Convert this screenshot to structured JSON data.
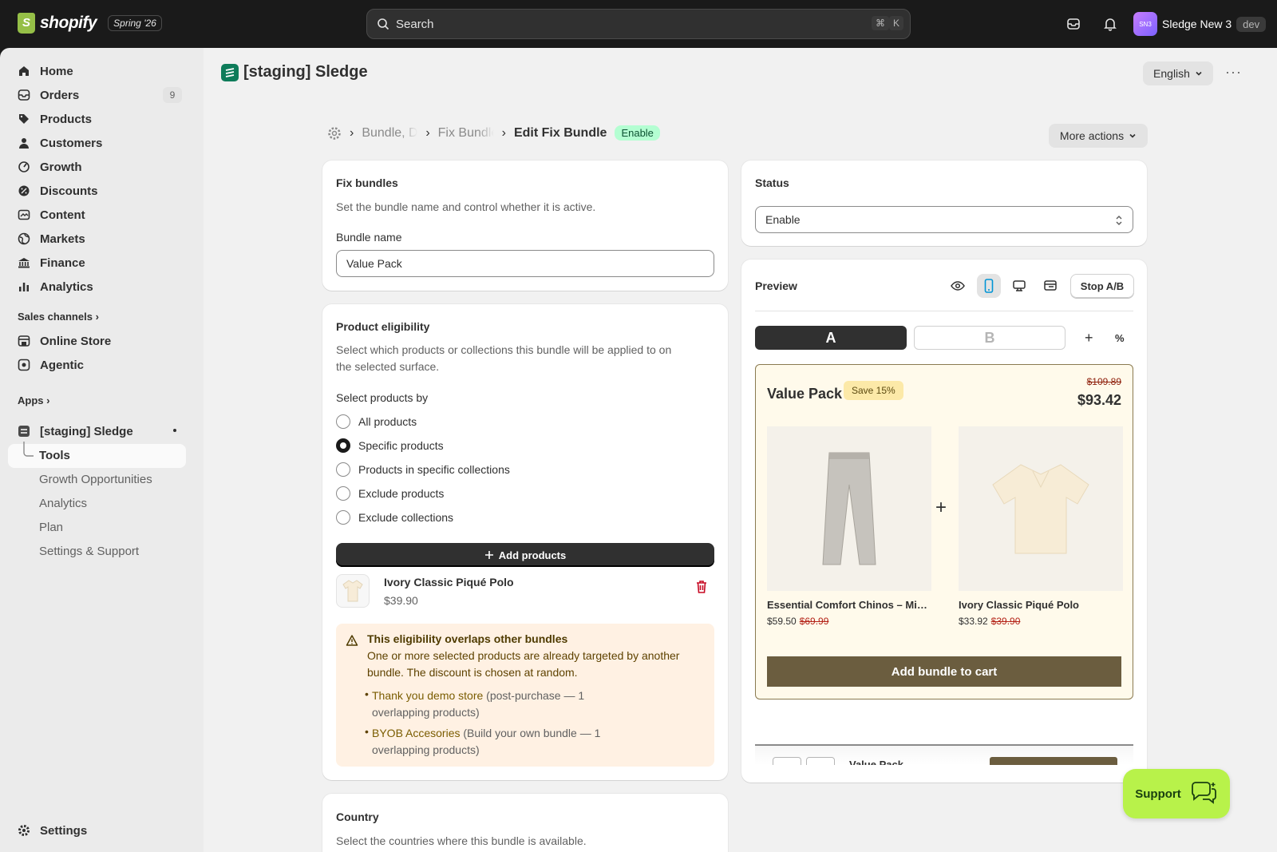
{
  "topbar": {
    "brand": "shopify",
    "edition": "Spring '26",
    "search_placeholder": "Search",
    "shortcut_cmd": "⌘",
    "shortcut_key": "K",
    "store_initials": "SN3",
    "store_name": "Sledge New 3",
    "env_tag": "dev"
  },
  "sidebar": {
    "items": [
      {
        "label": "Home",
        "icon": "home-icon"
      },
      {
        "label": "Orders",
        "icon": "orders-icon",
        "count": "9"
      },
      {
        "label": "Products",
        "icon": "tag-icon"
      },
      {
        "label": "Customers",
        "icon": "person-icon"
      },
      {
        "label": "Growth",
        "icon": "growth-icon"
      },
      {
        "label": "Discounts",
        "icon": "discount-icon"
      },
      {
        "label": "Content",
        "icon": "content-icon"
      },
      {
        "label": "Markets",
        "icon": "globe-icon"
      },
      {
        "label": "Finance",
        "icon": "bank-icon"
      },
      {
        "label": "Analytics",
        "icon": "bar-chart-icon"
      }
    ],
    "sales_channels_label": "Sales channels",
    "channels": [
      {
        "label": "Online Store",
        "icon": "store-icon"
      },
      {
        "label": "Agentic",
        "icon": "agentic-icon"
      }
    ],
    "apps_label": "Apps",
    "app_name": "[staging] Sledge",
    "app_subitems": [
      "Tools",
      "Growth Opportunities",
      "Analytics",
      "Plan",
      "Settings & Support"
    ],
    "settings_label": "Settings"
  },
  "header": {
    "app_title": "[staging] Sledge",
    "language": "English",
    "more_label": "···"
  },
  "breadcrumb": {
    "crumb1": "Bundle, Discounts",
    "crumb2": "Fix Bundles",
    "current": "Edit Fix Bundle",
    "status_badge": "Enable",
    "more_actions": "More actions"
  },
  "fix_bundles_card": {
    "title": "Fix bundles",
    "description": "Set the bundle name and control whether it is active.",
    "name_label": "Bundle name",
    "name_value": "Value Pack"
  },
  "eligibility_card": {
    "title": "Product eligibility",
    "description_line1": "Select which products or collections this bundle will be applied to on",
    "description_line2": "the selected surface.",
    "select_by_label": "Select products by",
    "options": [
      "All products",
      "Specific products",
      "Products in specific collections",
      "Exclude products",
      "Exclude collections"
    ],
    "selected_option": "Specific products",
    "add_button": "Add products",
    "selected_product_name": "Ivory Classic Piqué Polo",
    "selected_product_price": "$39.90",
    "warning": {
      "title": "This eligibility overlaps other bundles",
      "body_line1": "One or more selected products are already targeted by another",
      "body_line2": "bundle. The discount is chosen at random.",
      "item1_link": "Thank you demo store",
      "item1_rest": " (post-purchase — 1",
      "item1_line2": "overlapping products)",
      "item2_link": "BYOB Accesories",
      "item2_rest": " (Build your own bundle — 1",
      "item2_line2": "overlapping products)"
    }
  },
  "country_card": {
    "title": "Country",
    "description": "Select the countries where this bundle is available."
  },
  "status_card": {
    "title": "Status",
    "value": "Enable"
  },
  "preview_card": {
    "title": "Preview",
    "stop_ab": "Stop A/B",
    "variant_a": "A",
    "variant_b": "B",
    "plus": "+",
    "percent": "%",
    "widget": {
      "title": "Value Pack",
      "save_badge": "Save 15%",
      "old_total": "$109.89",
      "new_total": "$93.42",
      "products": [
        {
          "name": "Essential Comfort Chinos – Mis…",
          "price": "$59.50",
          "old_price": "$69.99"
        },
        {
          "name": "Ivory Classic Piqué Polo",
          "price": "$33.92",
          "old_price": "$39.90"
        }
      ],
      "cta": "Add bundle to cart"
    },
    "peek_title": "Value Pack"
  },
  "support": {
    "label": "Support"
  },
  "colors": {
    "accent": "#303030",
    "success_bg": "#b4fed2",
    "warning_bg": "#fff1e3",
    "widget_cta": "#6b5d3f",
    "support_bg": "#b8f24a"
  }
}
